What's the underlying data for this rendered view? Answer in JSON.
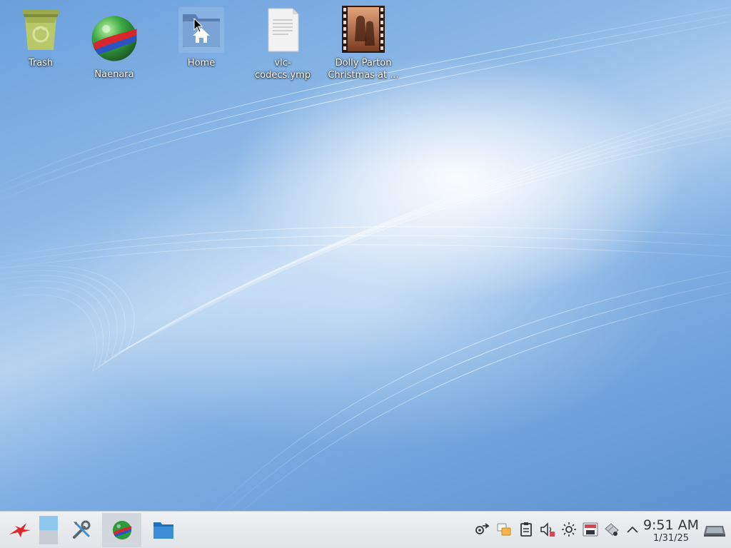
{
  "desktop": {
    "icons": [
      {
        "label": "Trash",
        "icon": "trash-icon"
      },
      {
        "label": "Naenara",
        "icon": "globe-browser-icon"
      },
      {
        "label": "Home",
        "icon": "home-folder-icon"
      },
      {
        "label": "vlc-codecs.ymp",
        "icon": "text-file-icon"
      },
      {
        "label": "Dolly Parton\nChristmas at ...",
        "icon": "video-file-icon"
      }
    ]
  },
  "taskbar": {
    "launchers": [
      {
        "name": "application-menu",
        "icon": "red-star-icon"
      },
      {
        "name": "desktop-pager",
        "icon": "pager-icon"
      },
      {
        "name": "system-settings",
        "icon": "tools-icon"
      },
      {
        "name": "naenara-browser",
        "icon": "globe-browser-icon"
      },
      {
        "name": "file-manager",
        "icon": "folder-icon"
      }
    ],
    "tray": {
      "icons": [
        "network-icon",
        "notifications-icon",
        "clipboard-icon",
        "volume-muted-icon",
        "brightness-icon",
        "storage-icon",
        "removable-device-icon",
        "expand-tray-icon"
      ]
    },
    "clock": {
      "time": "9:51 AM",
      "date": "1/31/25"
    },
    "show_desktop_icon": "show-desktop-icon"
  },
  "colors": {
    "desktop_blue": "#5f95d2",
    "taskbar_bg": "#e6e8eb",
    "label_text": "#ffffff",
    "clock_text": "#31363b"
  }
}
